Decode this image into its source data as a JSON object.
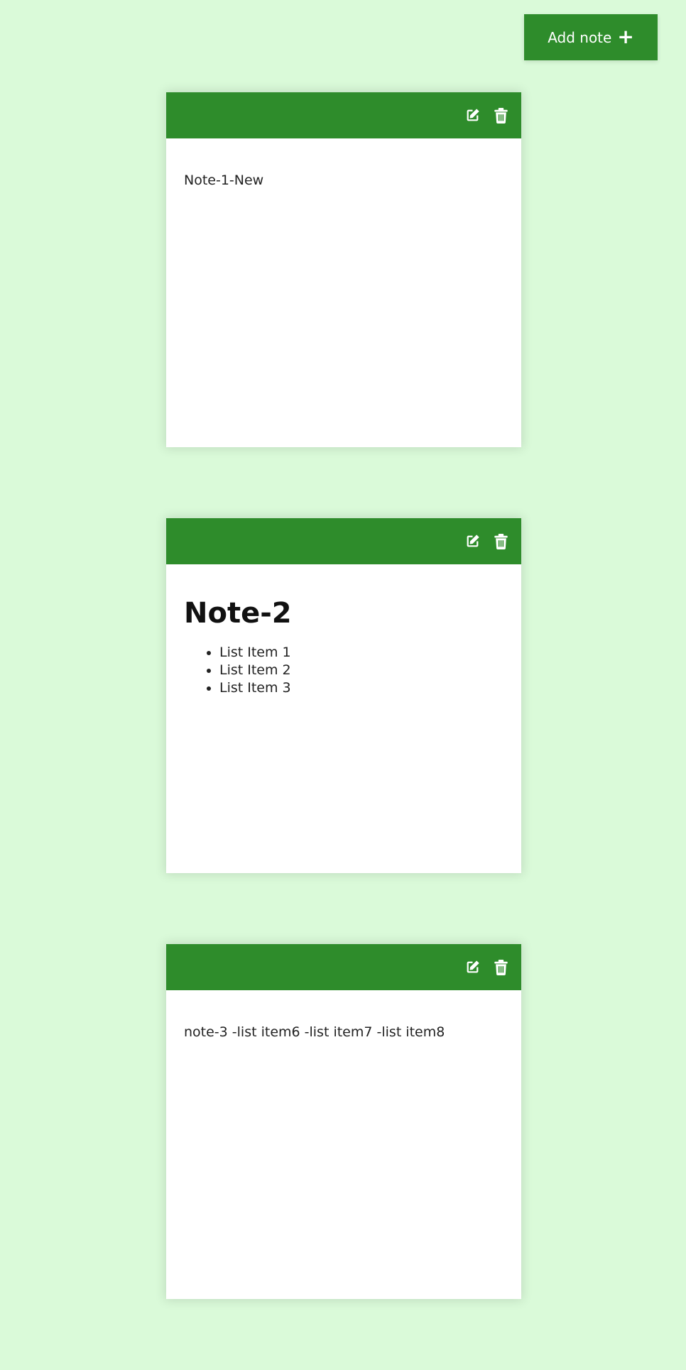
{
  "toolbar": {
    "add_note_label": "Add note",
    "add_icon": "plus-icon"
  },
  "colors": {
    "background": "#dafad9",
    "accent": "#2e8c2b",
    "card": "#ffffff"
  },
  "notes": [
    {
      "text": "Note-1-New",
      "edit_icon": "edit-icon",
      "delete_icon": "trash-icon"
    },
    {
      "heading": "Note-2",
      "list": [
        "List Item 1",
        "List Item 2",
        "List Item 3"
      ],
      "edit_icon": "edit-icon",
      "delete_icon": "trash-icon"
    },
    {
      "text": "note-3 -list item6 -list item7 -list item8",
      "edit_icon": "edit-icon",
      "delete_icon": "trash-icon"
    }
  ]
}
